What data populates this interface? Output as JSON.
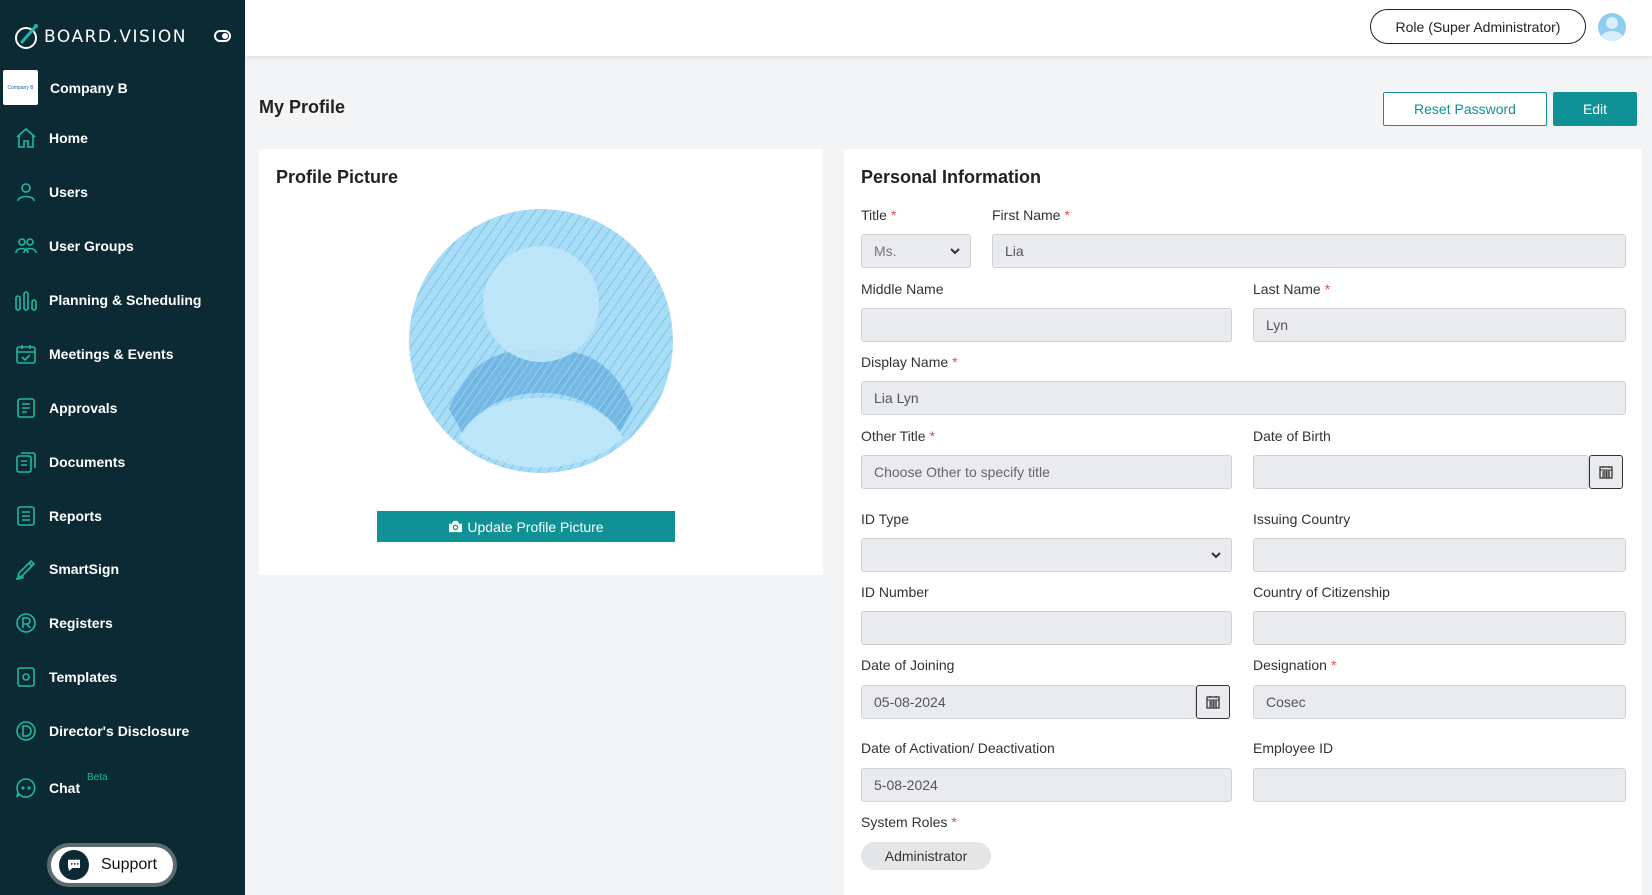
{
  "brand": {
    "name": "BOARD.VISION"
  },
  "company": {
    "name": "Company B",
    "logo_text": "Company B"
  },
  "nav": [
    {
      "label": "Home",
      "icon": "home-icon"
    },
    {
      "label": "Users",
      "icon": "user-icon"
    },
    {
      "label": "User Groups",
      "icon": "users-icon"
    },
    {
      "label": "Planning & Scheduling",
      "icon": "bars-icon"
    },
    {
      "label": "Meetings & Events",
      "icon": "calendar-check-icon"
    },
    {
      "label": "Approvals",
      "icon": "document-icon"
    },
    {
      "label": "Documents",
      "icon": "documents-icon"
    },
    {
      "label": "Reports",
      "icon": "list-icon"
    },
    {
      "label": "SmartSign",
      "icon": "pen-icon"
    },
    {
      "label": "Registers",
      "icon": "registered-icon"
    },
    {
      "label": "Templates",
      "icon": "template-icon"
    },
    {
      "label": "Director's Disclosure",
      "icon": "d-circle-icon"
    },
    {
      "label": "Chat",
      "icon": "chat-icon",
      "badge": "Beta"
    }
  ],
  "support": {
    "label": "Support"
  },
  "topbar": {
    "role_label": "Role (Super Administrator)"
  },
  "page": {
    "title": "My Profile",
    "reset_password_label": "Reset Password",
    "edit_label": "Edit"
  },
  "profile_card": {
    "title": "Profile Picture",
    "update_label": "Update Profile Picture"
  },
  "personal": {
    "title": "Personal Information",
    "title_label": "Title",
    "title_value": "Ms.",
    "first_name_label": "First Name",
    "first_name_value": "Lia",
    "middle_name_label": "Middle Name",
    "middle_name_value": "",
    "last_name_label": "Last Name",
    "last_name_value": "Lyn",
    "display_name_label": "Display Name",
    "display_name_value": "Lia Lyn",
    "other_title_label": "Other Title",
    "other_title_placeholder": "Choose Other to specify title",
    "dob_label": "Date of Birth",
    "dob_value": "",
    "id_type_label": "ID Type",
    "id_type_value": "",
    "issuing_country_label": "Issuing Country",
    "issuing_country_value": "",
    "id_number_label": "ID Number",
    "id_number_value": "",
    "citizenship_label": "Country of Citizenship",
    "citizenship_value": "",
    "date_joining_label": "Date of Joining",
    "date_joining_value": "05-08-2024",
    "designation_label": "Designation",
    "designation_value": "Cosec",
    "activation_label": "Date of Activation/ Deactivation",
    "activation_value": "5-08-2024",
    "employee_id_label": "Employee ID",
    "employee_id_value": "",
    "system_roles_label": "System Roles",
    "system_roles": [
      "Administrator"
    ]
  },
  "colors": {
    "sidebar": "#0b2a33",
    "accent": "#0f9196",
    "icon": "#1fb8a8",
    "required": "#d9534f"
  }
}
